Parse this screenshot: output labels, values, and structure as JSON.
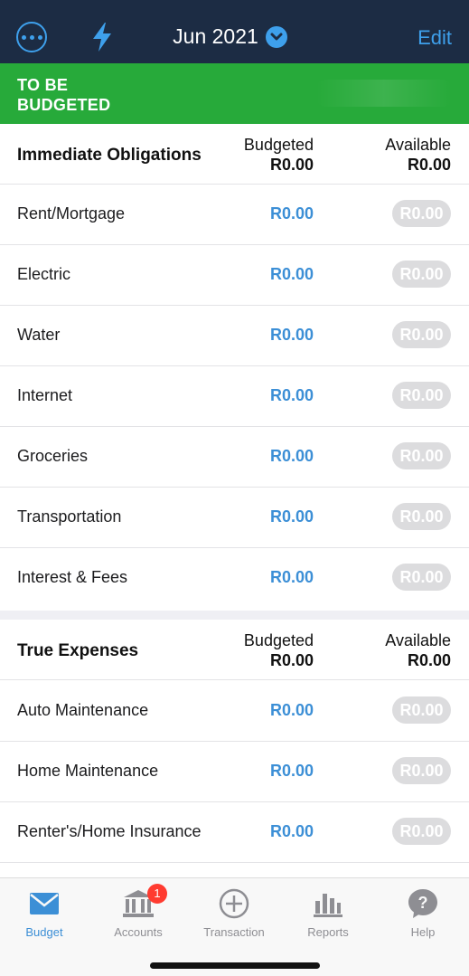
{
  "header": {
    "month": "Jun 2021",
    "edit_label": "Edit",
    "accent_color": "#3ea0ec",
    "background_color": "#1c2c44"
  },
  "to_be_budgeted": {
    "label_line1": "TO BE",
    "label_line2": "BUDGETED",
    "color": "#27aa3a"
  },
  "groups": [
    {
      "title": "Immediate Obligations",
      "budgeted_header": "Budgeted",
      "budgeted_total": "R0.00",
      "available_header": "Available",
      "available_total": "R0.00",
      "categories": [
        {
          "name": "Rent/Mortgage",
          "budgeted": "R0.00",
          "available": "R0.00"
        },
        {
          "name": "Electric",
          "budgeted": "R0.00",
          "available": "R0.00"
        },
        {
          "name": "Water",
          "budgeted": "R0.00",
          "available": "R0.00"
        },
        {
          "name": "Internet",
          "budgeted": "R0.00",
          "available": "R0.00"
        },
        {
          "name": "Groceries",
          "budgeted": "R0.00",
          "available": "R0.00"
        },
        {
          "name": "Transportation",
          "budgeted": "R0.00",
          "available": "R0.00"
        },
        {
          "name": "Interest & Fees",
          "budgeted": "R0.00",
          "available": "R0.00"
        }
      ]
    },
    {
      "title": "True Expenses",
      "budgeted_header": "Budgeted",
      "budgeted_total": "R0.00",
      "available_header": "Available",
      "available_total": "R0.00",
      "categories": [
        {
          "name": "Auto Maintenance",
          "budgeted": "R0.00",
          "available": "R0.00"
        },
        {
          "name": "Home Maintenance",
          "budgeted": "R0.00",
          "available": "R0.00"
        },
        {
          "name": "Renter's/Home Insurance",
          "budgeted": "R0.00",
          "available": "R0.00"
        }
      ]
    }
  ],
  "tabbar": {
    "tabs": [
      {
        "label": "Budget",
        "icon": "envelope-icon",
        "active": true
      },
      {
        "label": "Accounts",
        "icon": "bank-icon",
        "badge": "1"
      },
      {
        "label": "Transaction",
        "icon": "plus-circle-icon"
      },
      {
        "label": "Reports",
        "icon": "bar-chart-icon"
      },
      {
        "label": "Help",
        "icon": "question-bubble-icon"
      }
    ],
    "active_color": "#3c8fd6",
    "inactive_color": "#8e8e93"
  }
}
